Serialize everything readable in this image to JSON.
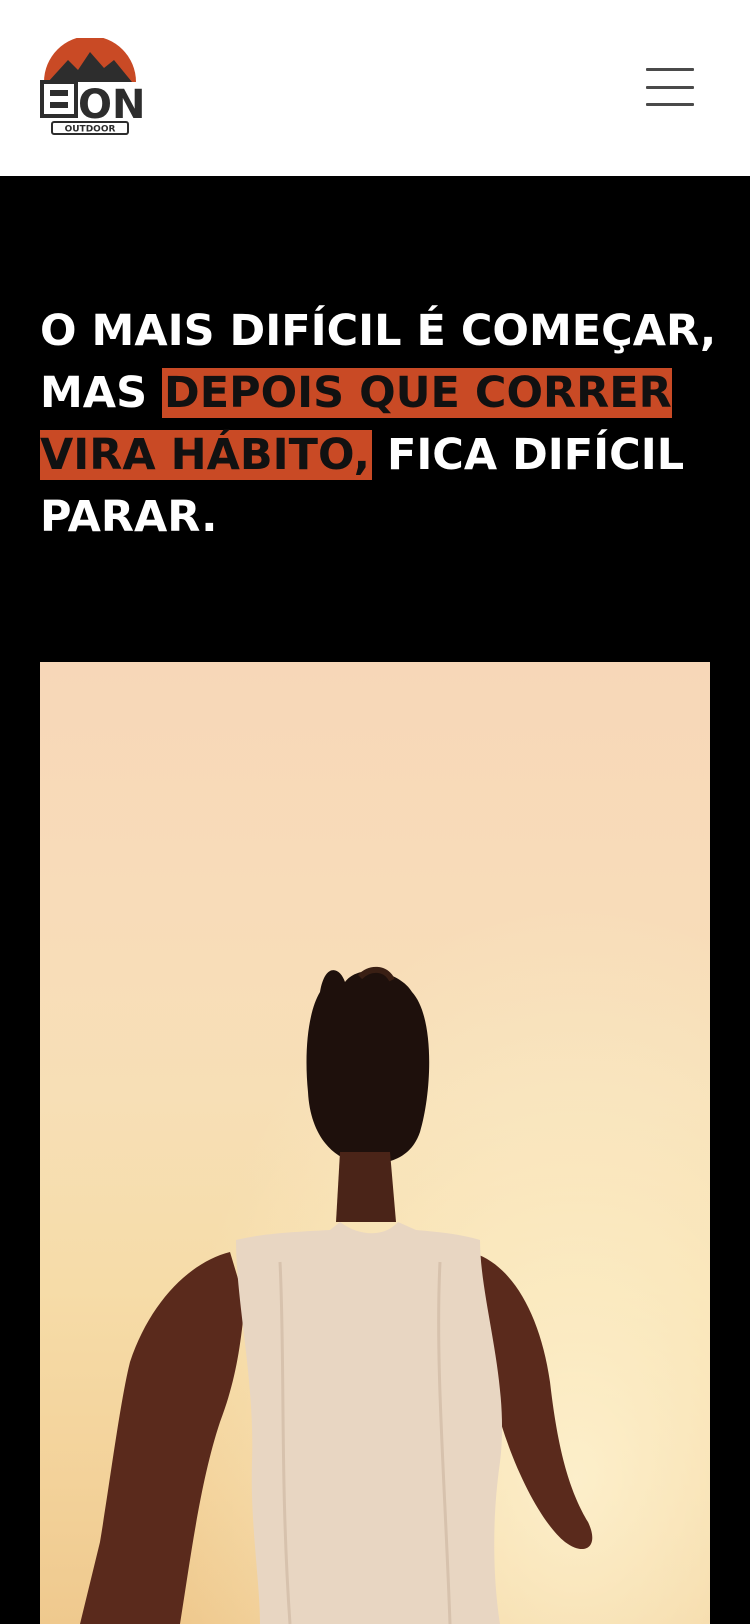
{
  "header": {
    "logo_alt": "ON OUTDOOR",
    "logo_text_main": "ON",
    "logo_text_sub": "OUTDOOR",
    "menu_icon": "hamburger-menu-icon"
  },
  "hero": {
    "headline_part1": "O MAIS DIFÍCIL É COMEÇAR, MAS ",
    "headline_highlight": "DEPOIS QUE CORRER VIRA HÁBITO,",
    "headline_part2": " FICA DIFÍCIL PARAR.",
    "image_description": "runner-photo"
  },
  "colors": {
    "accent": "#c94a25",
    "header_bg": "#ffffff",
    "hero_bg": "#000000",
    "headline_text": "#ffffff"
  }
}
